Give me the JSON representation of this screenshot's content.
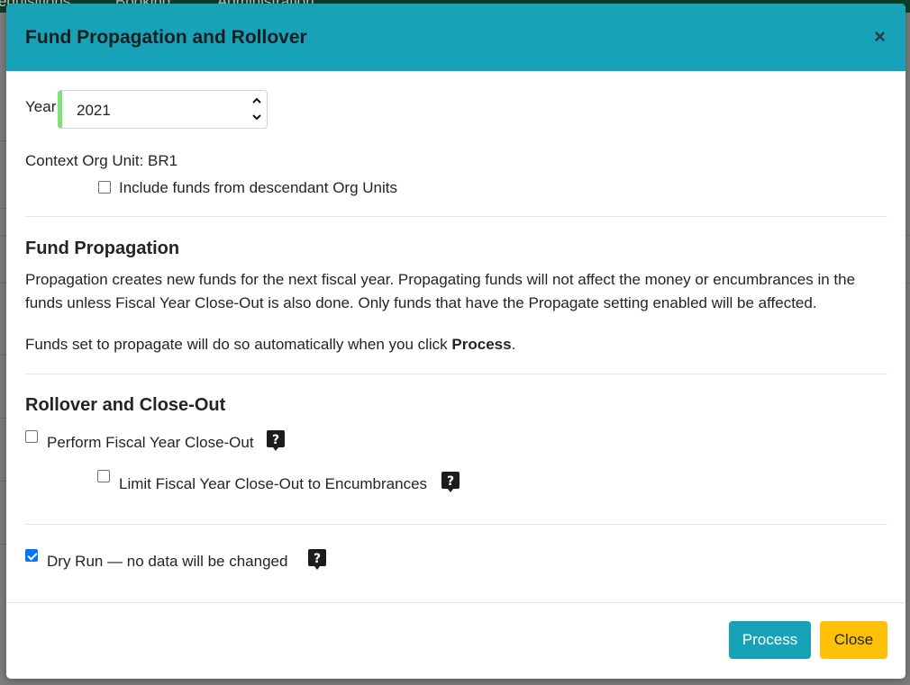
{
  "background": {
    "nav_items": [
      "equisitions",
      "Booking",
      "Administration"
    ]
  },
  "modal": {
    "title": "Fund Propagation and Rollover",
    "close_glyph": "×",
    "year_label": "Year",
    "year_value": "2021",
    "context_org_unit": "Context Org Unit: BR1",
    "include_descendants_label": "Include funds from descendant Org Units",
    "include_descendants_checked": false,
    "fund_propagation": {
      "heading": "Fund Propagation",
      "paragraph1": "Propagation creates new funds for the next fiscal year. Propagating funds will not affect the money or encumbrances in the funds unless Fiscal Year Close-Out is also done. Only funds that have the Propagate setting enabled will be affected.",
      "paragraph2_prefix": "Funds set to propagate will do so automatically when you click ",
      "paragraph2_bold": "Process",
      "paragraph2_suffix": "."
    },
    "rollover": {
      "heading": "Rollover and Close-Out",
      "perform_closeout_label": "Perform Fiscal Year Close-Out",
      "perform_closeout_checked": false,
      "limit_closeout_label": "Limit Fiscal Year Close-Out to Encumbrances",
      "limit_closeout_checked": false
    },
    "dry_run_label": "Dry Run — no data will be changed",
    "dry_run_checked": true,
    "buttons": {
      "process": "Process",
      "close": "Close"
    },
    "colors": {
      "header": "#17a2b8",
      "process_button": "#17a2b8",
      "close_button": "#ffc107",
      "year_valid_border": "#7ee07a"
    }
  }
}
